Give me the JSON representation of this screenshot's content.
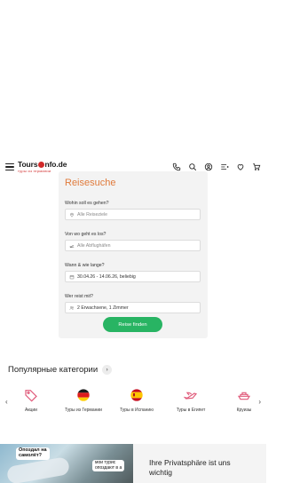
{
  "header": {
    "logo_main_before": "Tours",
    "logo_main_after": "nfo.de",
    "logo_sub": "туры из германии",
    "icons": [
      "menu-icon",
      "phone-icon",
      "search-icon",
      "account-icon",
      "list-icon",
      "heart-icon",
      "cart-icon"
    ]
  },
  "search": {
    "title": "Reisesuche",
    "destination_label": "Wohin soll es gehen?",
    "destination_placeholder": "Alle Reiseziele",
    "departure_label": "Von wo geht es los?",
    "departure_placeholder": "Alle Abflughäfen",
    "dates_label": "Wann & wie lange?",
    "dates_value": "30.04.26 - 14.06.26, beliebig",
    "travelers_label": "Wer reist mit?",
    "travelers_value": "2 Erwachsene, 1 Zimmer",
    "submit_label": "Reise finden",
    "accent_color": "#e07b3c",
    "button_color": "#28b463"
  },
  "categories": {
    "title": "Популярные категории",
    "items": [
      {
        "label": "Акции",
        "icon": "tag-icon"
      },
      {
        "label": "Туры из Германии",
        "icon": "germany-flag-icon"
      },
      {
        "label": "Туры в Испанию",
        "icon": "spain-flag-icon"
      },
      {
        "label": "Туры в Египет",
        "icon": "airplane-icon"
      },
      {
        "label": "Круизы",
        "icon": "ship-icon"
      }
    ]
  },
  "promo": {
    "bubble1_line1": "Опоздал на",
    "bubble1_line2": "самолёт?",
    "bubble2_line1": "мои турис",
    "bubble2_line2": "опоздают в а"
  },
  "privacy": {
    "text_line1": "Ihre Privatsphäre ist uns",
    "text_line2": "wichtig"
  }
}
